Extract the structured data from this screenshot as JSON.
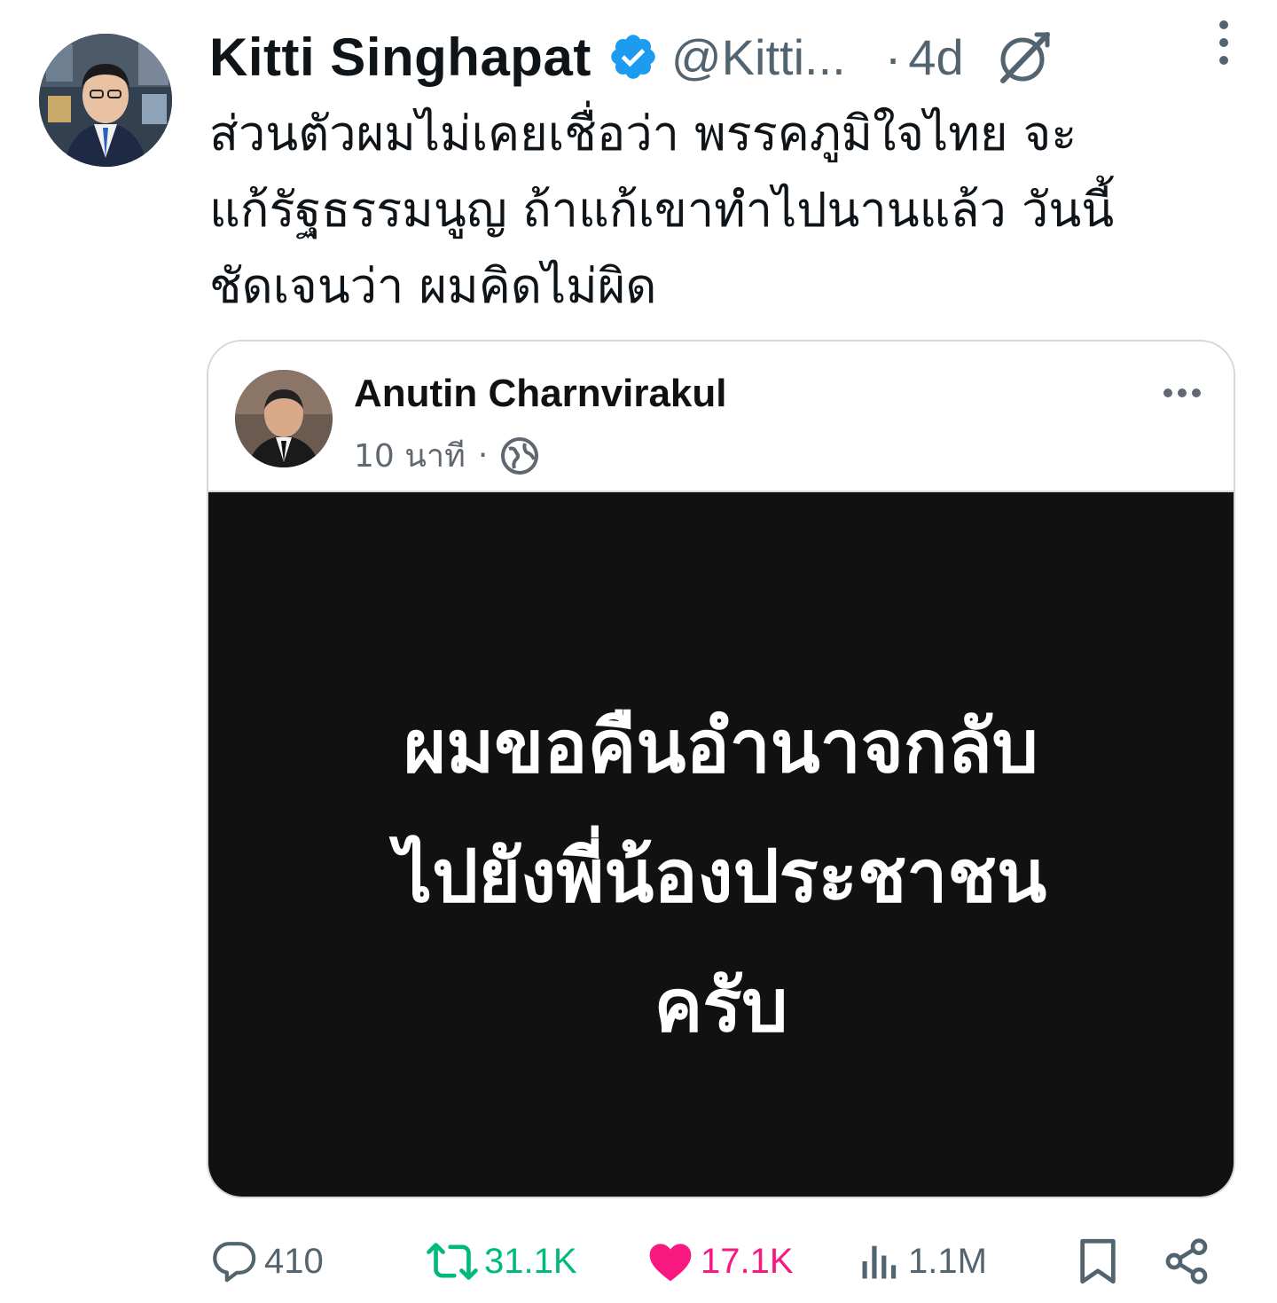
{
  "author": {
    "name": "Kitti  Singhapat",
    "handle": "@Kitti...",
    "time": "4d",
    "dot": "·"
  },
  "text": {
    "line1": "ส่วนตัวผมไม่เคยเชื่อว่า พรรคภูมิใจไทย จะ",
    "line2": "แก้รัฐธรรมนูญ ถ้าแก้เขาทำไปนานแล้ว วันนี้",
    "line3": "ชัดเจนว่า ผมคิดไม่ผิด"
  },
  "embedded_post": {
    "author_name": "Anutin Charnvirakul",
    "time": "10 นาที",
    "separator": "·",
    "image_text": {
      "line1": "ผมขอคืนอำนาจกลับ",
      "line2": "ไปยังพี่น้องประชาชน",
      "line3": "ครับ"
    }
  },
  "actions": {
    "replies": "410",
    "retweets": "31.1K",
    "likes": "17.1K",
    "views": "1.1M"
  },
  "colors": {
    "verified": "#1d9bf0",
    "retweet": "#00ba7c",
    "like": "#f91880",
    "muted": "#536471"
  },
  "icons": [
    "verified-icon",
    "grok-icon",
    "more-vertical-icon",
    "more-horizontal-icon",
    "globe-icon",
    "reply-icon",
    "retweet-icon",
    "like-icon",
    "views-icon",
    "bookmark-icon",
    "share-icon"
  ]
}
